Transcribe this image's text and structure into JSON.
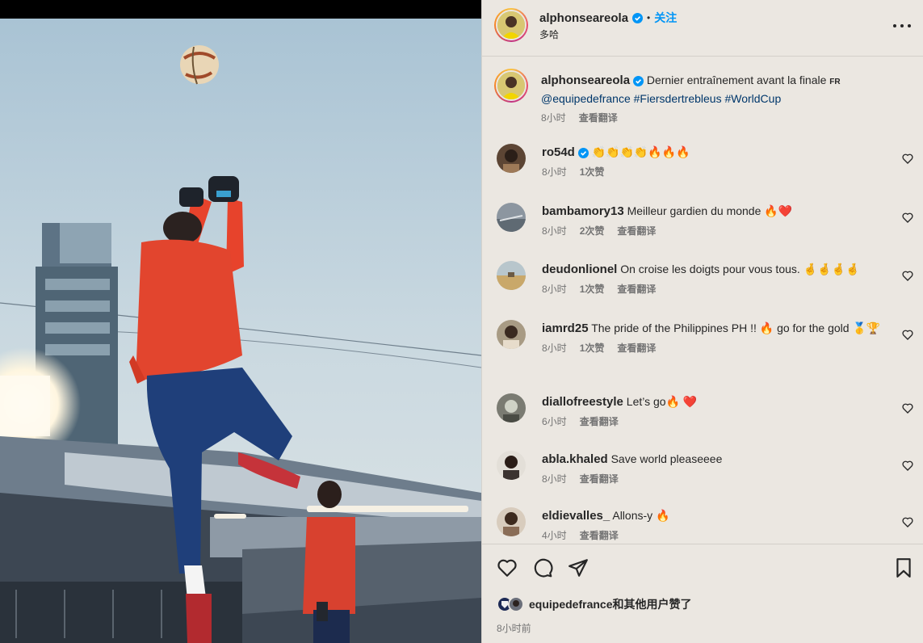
{
  "post": {
    "username": "alphonseareola",
    "follow_label": "关注",
    "location": "多哈",
    "more_label": "more options",
    "caption": {
      "username": "alphonseareola",
      "text": "Dernier entraînement avant la finale",
      "flag": "FR",
      "tags": [
        "@equipedefrance",
        "#Fiersdertrebleus",
        "#WorldCup"
      ],
      "time": "8小时",
      "translate": "查看翻译"
    }
  },
  "comments": [
    {
      "username": "ro54d",
      "verified": true,
      "text": "👏👏👏👏🔥🔥🔥",
      "time": "8小时",
      "likes": "1次赞",
      "translate": ""
    },
    {
      "username": "bambamory13",
      "text": "Meilleur gardien du monde 🔥❤️",
      "time": "8小时",
      "likes": "2次赞",
      "translate": "查看翻译"
    },
    {
      "username": "deudonlionel",
      "text": "On croise les doigts pour vous tous. 🤞🤞🤞🤞",
      "time": "8小时",
      "likes": "1次赞",
      "translate": "查看翻译"
    },
    {
      "username": "iamrd25",
      "text": "The pride of the Philippines PH !! 🔥 go for the gold 🥇🏆",
      "time": "8小时",
      "likes": "1次赞",
      "translate": "查看翻译"
    },
    {
      "username": "diallofreestyle",
      "text": "Let’s go🔥 ❤️",
      "time": "6小时",
      "likes": "",
      "translate": "查看翻译"
    },
    {
      "username": "abla.khaled",
      "text": "Save world pleaseeee",
      "time": "8小时",
      "likes": "",
      "translate": "查看翻译"
    },
    {
      "username": "eldievalles_",
      "text": "Allons-y 🔥",
      "time": "4小时",
      "likes": "",
      "translate": "查看翻译"
    }
  ],
  "actions": {
    "likers_user": "equipedefrance",
    "likers_suffix": "和其他用户赞了",
    "posted_ago": "8小时前"
  },
  "colors": {
    "panel_bg": "#ebe7e1",
    "link": "#0095f6",
    "tag": "#00376b",
    "muted": "#737373"
  }
}
